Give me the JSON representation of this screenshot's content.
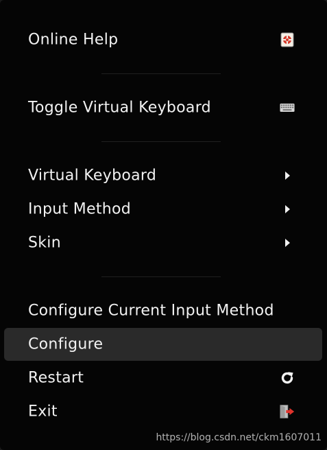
{
  "menu": {
    "items": [
      {
        "label": "Online Help",
        "icon": "help-lifebuoy-icon"
      },
      {
        "label": "Toggle Virtual Keyboard",
        "icon": "keyboard-icon"
      },
      {
        "label": "Virtual Keyboard",
        "icon": "submenu-arrow-icon"
      },
      {
        "label": "Input Method",
        "icon": "submenu-arrow-icon"
      },
      {
        "label": "Skin",
        "icon": "submenu-arrow-icon"
      },
      {
        "label": "Configure Current Input Method"
      },
      {
        "label": "Configure",
        "selected": true
      },
      {
        "label": "Restart",
        "icon": "restart-icon"
      },
      {
        "label": "Exit",
        "icon": "exit-icon"
      }
    ]
  },
  "watermark": {
    "text": "https://blog.csdn.net/ckm1607011"
  },
  "colors": {
    "menu_background": "#050505",
    "selected_background": "#2a2a2a",
    "text": "#f2f2f2",
    "exit_arrow": "#e0332c",
    "help_icon_red": "#d33a2c"
  }
}
